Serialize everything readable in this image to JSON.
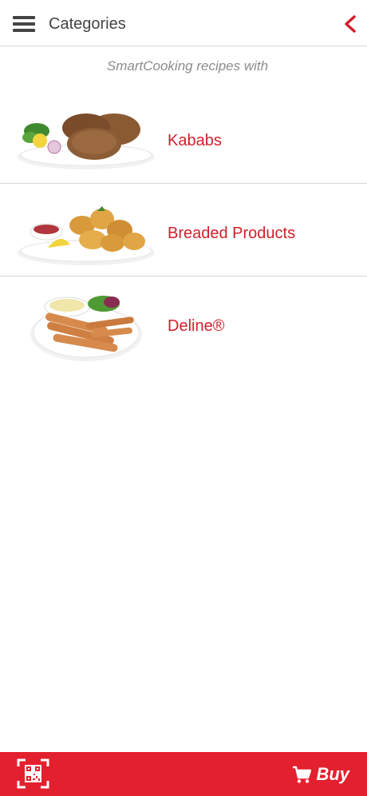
{
  "header": {
    "title": "Categories",
    "menu_icon": "hamburger-menu-icon",
    "back_icon": "chevron-left-icon"
  },
  "subtitle": "SmartCooking recipes with",
  "categories": [
    {
      "label": "Kababs",
      "image": "kababs-plate-image"
    },
    {
      "label": "Breaded Products",
      "image": "breaded-products-plate-image"
    },
    {
      "label": "Deline®",
      "image": "deline-sausages-plate-image"
    }
  ],
  "footer": {
    "qr_icon": "qr-code-scan-icon",
    "cart_icon": "shopping-cart-icon",
    "buy_label": "Buy"
  },
  "colors": {
    "accent": "#d0202a",
    "footer_bg": "#e3202e",
    "header_text": "#444444",
    "subtitle_text": "#8c8c8c"
  }
}
